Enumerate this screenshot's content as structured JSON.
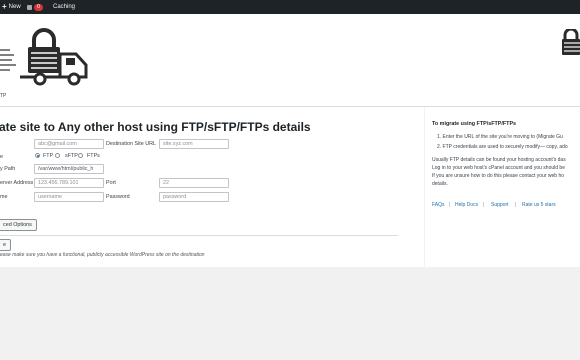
{
  "admin_bar": {
    "new_label": "New",
    "comments_count": "0",
    "caching_label": "Caching"
  },
  "header": {
    "nav_fragment": "TP"
  },
  "main": {
    "title": "ate site to Any other host using FTP/sFTP/FTPs details",
    "fields": {
      "email_label": "",
      "email_placeholder": "abc@gmail.com",
      "dest_url_label": "Destination Site URL",
      "dest_url_placeholder": "site.xyz.com",
      "protocol_label": "e",
      "protocol_options": [
        "FTP",
        "sFTP",
        "FTPs"
      ],
      "protocol_selected": "FTP",
      "path_label": "y Path",
      "path_value": "/var/www/html/public_h",
      "server_label": "erver Address",
      "server_placeholder": "123.456.789.101",
      "port_label": "Port",
      "port_placeholder": "22",
      "username_label": "me",
      "username_placeholder": "username",
      "password_label": "Password",
      "password_placeholder": "password"
    },
    "advanced_button": "ced Options",
    "migrate_button": "e",
    "note": "ease make sure you have a functional, publicly accessible WordPress site on the destination"
  },
  "sidebar": {
    "heading": "To migrate using FTP/sFTP/FTPs",
    "steps": [
      "1. Enter the URL of the site you're moving to (Migrate Gu",
      "2. FTP credentials are used to securely modify— copy, ado"
    ],
    "help_lines": [
      "Usually FTP details can be found your hosting account's das",
      "Log in to your web host's cPanel account and you should be",
      "If you are unsure how to do this please contact your web ho",
      "details."
    ],
    "links": [
      "FAQs",
      "Help Docs",
      "Support",
      "Rate us 5 stars"
    ],
    "link_separator": "|"
  },
  "colors": {
    "admin_bar": "#1d2327",
    "accent": "#2271b1",
    "badge": "#d63638",
    "logo": "#2b2b2b"
  }
}
